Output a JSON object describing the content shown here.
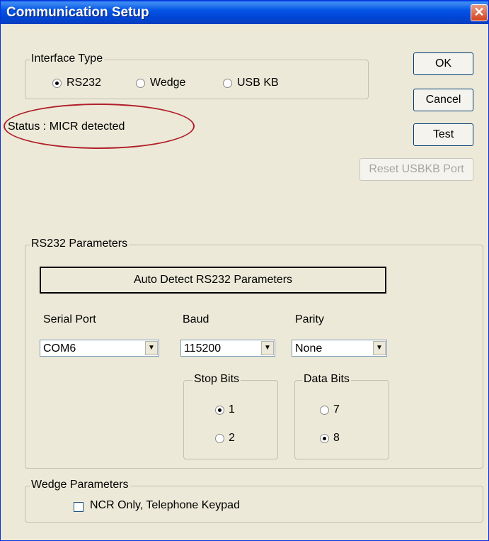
{
  "window": {
    "title": "Communication Setup",
    "close_glyph": "✕"
  },
  "interface_type": {
    "legend": "Interface Type",
    "options": [
      {
        "label": "RS232",
        "selected": true
      },
      {
        "label": "Wedge",
        "selected": false
      },
      {
        "label": "USB KB",
        "selected": false
      }
    ]
  },
  "status": {
    "text": "Status : MICR detected"
  },
  "buttons": {
    "ok": "OK",
    "cancel": "Cancel",
    "test": "Test",
    "reset_usbkb": "Reset USBKB Port"
  },
  "rs232": {
    "legend": "RS232 Parameters",
    "auto_detect_label": "Auto Detect RS232 Parameters",
    "serial_port": {
      "label": "Serial Port",
      "value": "COM6"
    },
    "baud": {
      "label": "Baud",
      "value": "115200"
    },
    "parity": {
      "label": "Parity",
      "value": "None"
    },
    "stop_bits": {
      "legend": "Stop Bits",
      "options": [
        {
          "label": "1",
          "selected": true
        },
        {
          "label": "2",
          "selected": false
        }
      ]
    },
    "data_bits": {
      "legend": "Data Bits",
      "options": [
        {
          "label": "7",
          "selected": false
        },
        {
          "label": "8",
          "selected": true
        }
      ]
    }
  },
  "wedge": {
    "legend": "Wedge Parameters",
    "ncr_only_label": "NCR Only, Telephone Keypad",
    "ncr_only_checked": false
  },
  "icons": {
    "dropdown_arrow": "▼"
  }
}
